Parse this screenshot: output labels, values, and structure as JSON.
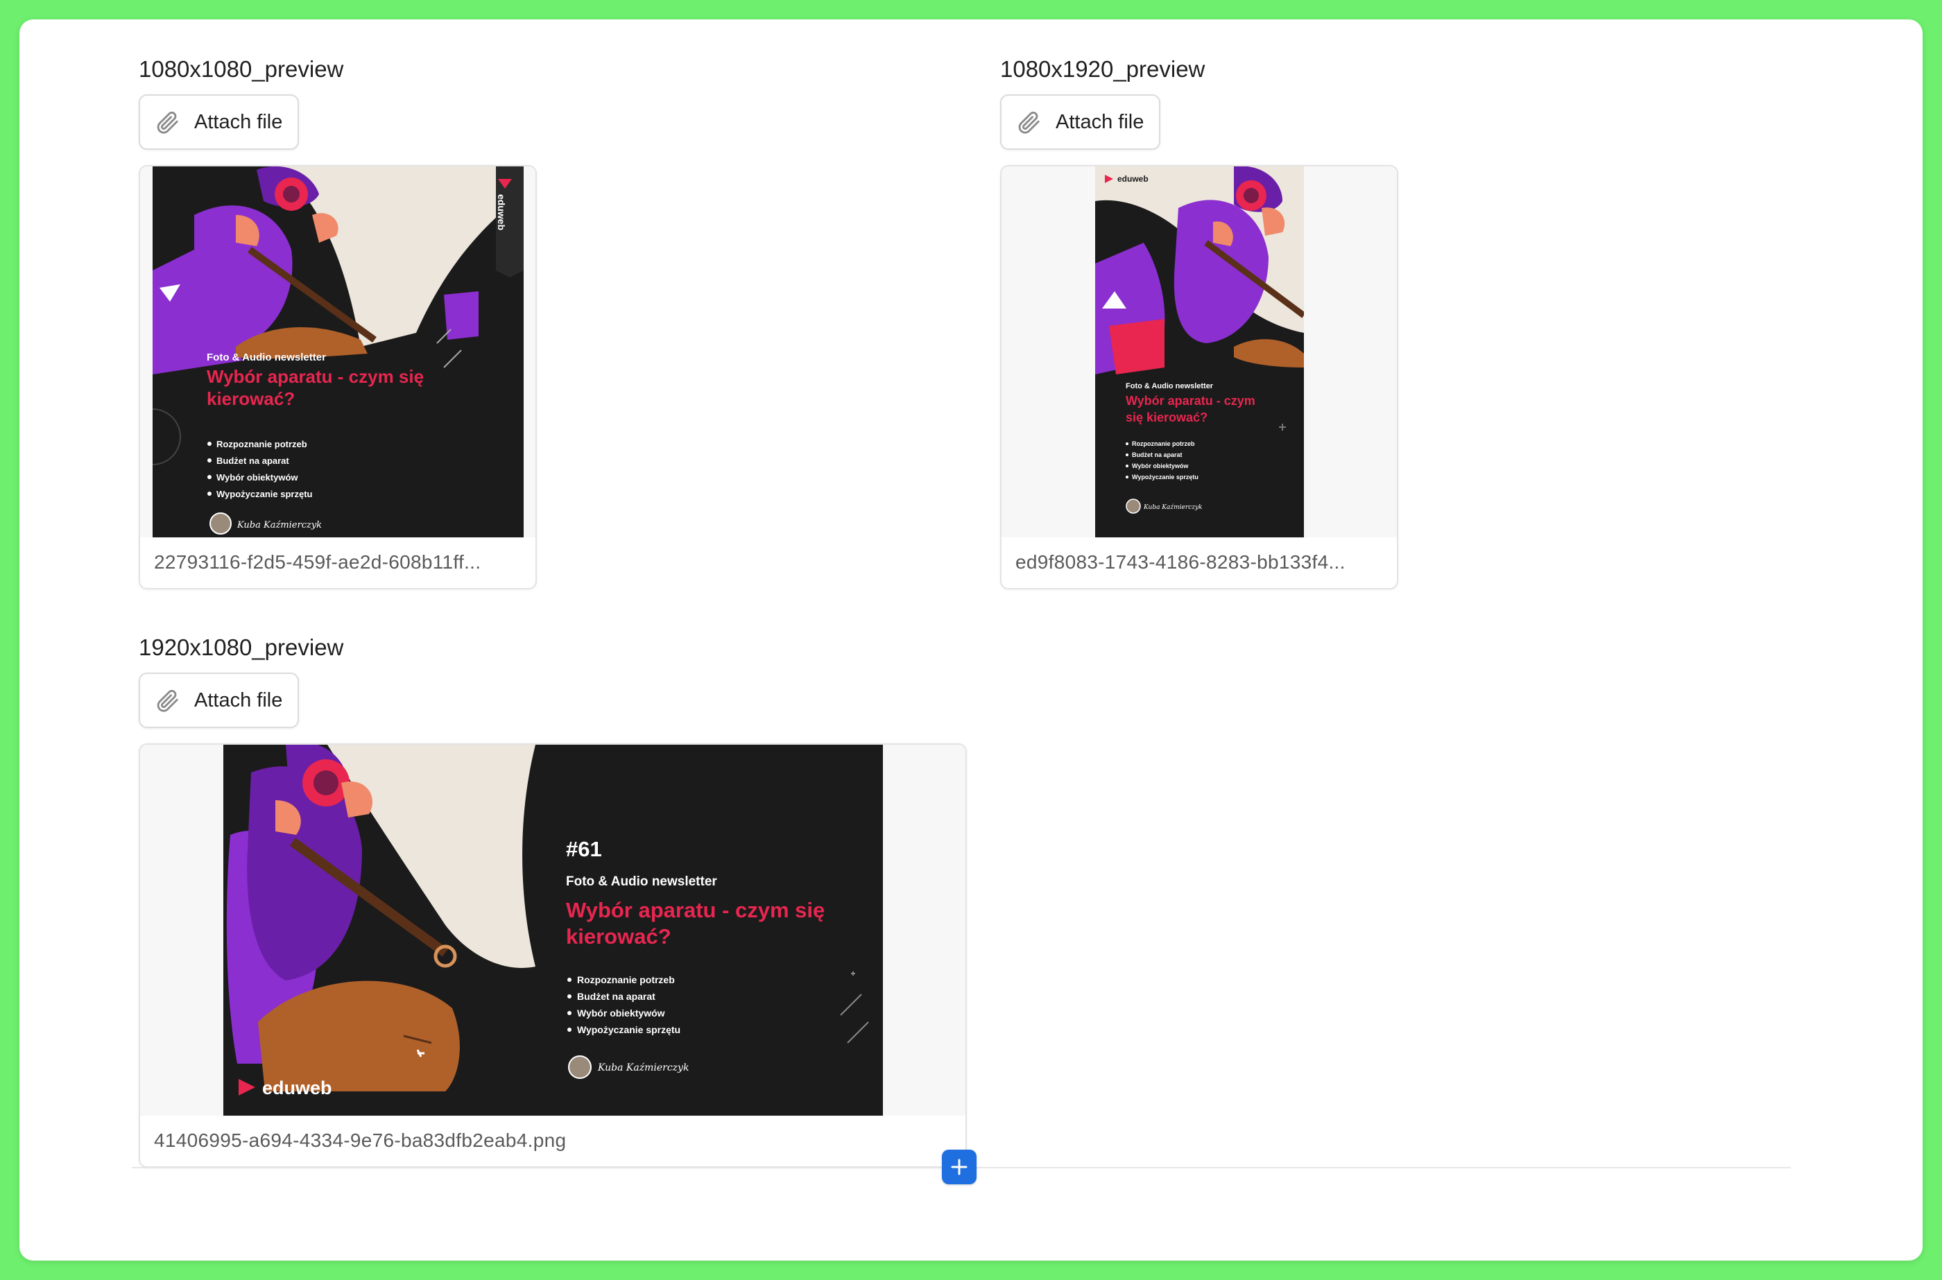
{
  "fields": [
    {
      "label": "1080x1080_preview",
      "attach_label": "Attach file",
      "filename": "22793116-f2d5-459f-ae2d-608b11ff...",
      "preview": {
        "brand": "eduweb",
        "subtitle": "Foto & Audio newsletter",
        "headline_1": "Wybór aparatu - czym się",
        "headline_2": "kierować?",
        "bullets": [
          "Rozpoznanie potrzeb",
          "Budżet na aparat",
          "Wybór obiektywów",
          "Wypożyczanie sprzętu"
        ],
        "signature": "Kuba Kaźmierczyk"
      }
    },
    {
      "label": "1080x1920_preview",
      "attach_label": "Attach file",
      "filename": "ed9f8083-1743-4186-8283-bb133f4...",
      "preview": {
        "brand": "eduweb",
        "subtitle": "Foto & Audio newsletter",
        "headline_1": "Wybór aparatu - czym",
        "headline_2": "się kierować?",
        "bullets": [
          "Rozpoznanie potrzeb",
          "Budżet na aparat",
          "Wybór obiektywów",
          "Wypożyczanie sprzętu"
        ],
        "signature": "Kuba Kaźmierczyk"
      }
    },
    {
      "label": "1920x1080_preview",
      "attach_label": "Attach file",
      "filename": "41406995-a694-4334-9e76-ba83dfb2eab4.png",
      "preview": {
        "brand": "eduweb",
        "issue": "#61",
        "subtitle": "Foto & Audio newsletter",
        "headline_1": "Wybór aparatu - czym się",
        "headline_2": "kierować?",
        "bullets": [
          "Rozpoznanie potrzeb",
          "Budżet na aparat",
          "Wybór obiektywów",
          "Wypożyczanie sprzętu"
        ],
        "signature": "Kuba Kaźmierczyk"
      }
    }
  ],
  "icons": {
    "attach": "paperclip-icon",
    "add": "plus-icon"
  },
  "colors": {
    "background": "#6ef06e",
    "accent": "#1f6fe0",
    "brand_red": "#e8264f",
    "poster_dark": "#1b1b1b",
    "purple": "#8b2fd0"
  }
}
